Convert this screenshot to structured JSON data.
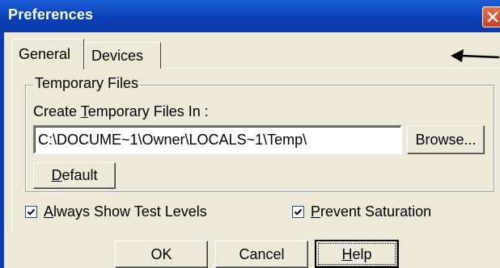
{
  "window": {
    "title": "Preferences"
  },
  "tabs": [
    {
      "label": "General",
      "active": true
    },
    {
      "label": "Devices",
      "active": false
    }
  ],
  "temp_files": {
    "group_title": "Temporary Files",
    "label_before": "Create ",
    "label_mnemonic": "T",
    "label_after": "emporary Files In :",
    "path_value": "C:\\DOCUME~1\\Owner\\LOCALS~1\\Temp\\",
    "browse_label": "Browse...",
    "default_mnemonic": "D",
    "default_rest": "efault"
  },
  "options": {
    "always_show": {
      "mnemonic": "A",
      "rest": "lways Show Test Levels",
      "checked": true
    },
    "prevent_saturation": {
      "mnemonic": "P",
      "rest": "revent Saturation",
      "checked": true
    }
  },
  "buttons": {
    "ok_label": "OK",
    "cancel_label": "Cancel",
    "help_mnemonic": "H",
    "help_rest": "elp"
  },
  "icons": {
    "close": "close-icon",
    "checkmark": "checkmark-icon",
    "annotation": "arrow-left-icon"
  },
  "colors": {
    "titlebar": "#0a3fb6",
    "dialog_bg": "#ece9d8",
    "close_button": "#c9401e"
  }
}
